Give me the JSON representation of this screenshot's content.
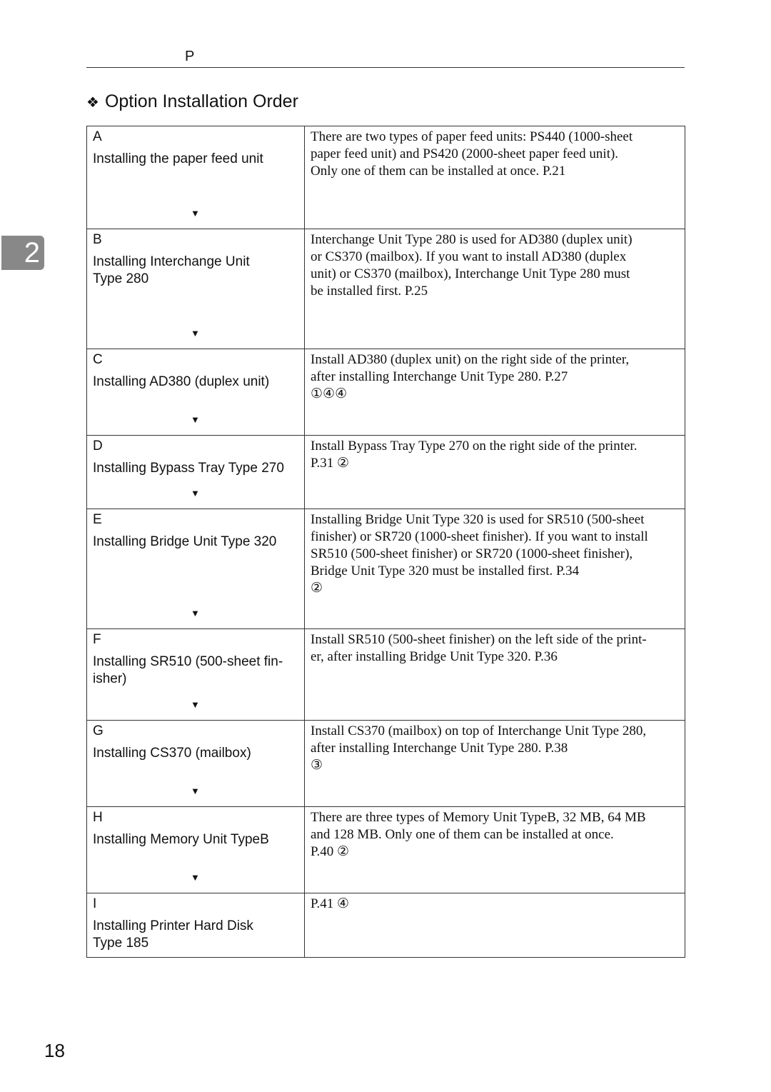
{
  "header": {
    "running_head": "P",
    "chapter_tab": "2",
    "page_number": "18"
  },
  "title": "Option Installation Order",
  "title_bullet": "❖",
  "rows": [
    {
      "letter": "A",
      "label": [
        "Installing the paper feed unit"
      ],
      "arrow": "▼",
      "height": 144,
      "desc": [
        "There are two types of paper feed units: PS440 (1000-sheet",
        "paper feed unit) and PS420 (2000-sheet paper feed unit).",
        "Only one of them can be installed at once.     P.21"
      ]
    },
    {
      "letter": "B",
      "label": [
        "Installing Interchange Unit",
        "Type 280"
      ],
      "arrow": "▼",
      "height": 168,
      "desc": [
        "Interchange Unit Type 280 is used for AD380 (duplex unit)",
        "or CS370 (mailbox). If you want to install AD380 (duplex",
        "unit) or CS370 (mailbox), Interchange Unit Type 280 must",
        "be installed first.     P.25"
      ]
    },
    {
      "letter": "C",
      "label": [
        "Installing AD380 (duplex unit)"
      ],
      "arrow": "▼",
      "height": 121,
      "desc": [
        "Install AD380 (duplex unit) on the right side of the printer,",
        "after installing Interchange Unit Type 280.     P.27",
        "①④④"
      ]
    },
    {
      "letter": "D",
      "label": [
        "Installing Bypass Tray Type 270"
      ],
      "arrow": "▼",
      "height": 103,
      "desc": [
        "Install Bypass Tray Type 270 on the right side of the printer.",
        "    P.31   ②"
      ]
    },
    {
      "letter": "E",
      "label": [
        "Installing Bridge Unit Type 320"
      ],
      "arrow": "▼",
      "height": 168,
      "desc": [
        "Installing Bridge Unit Type 320 is used for SR510 (500-sheet",
        "finisher) or SR720 (1000-sheet finisher). If you want to install",
        "SR510 (500-sheet finisher) or SR720 (1000-sheet finisher),",
        "Bridge Unit Type 320 must be installed first.     P.34",
        "②"
      ]
    },
    {
      "letter": "F",
      "label": [
        "Installing SR510 (500-sheet fin-",
        "isher)"
      ],
      "arrow": "▼",
      "height": 128,
      "desc": [
        "Install SR510 (500-sheet finisher) on the left side of the print-",
        "er, after installing Bridge Unit Type 320.     P.36"
      ]
    },
    {
      "letter": "G",
      "label": [
        "Installing CS370 (mailbox)"
      ],
      "arrow": "▼",
      "height": 121,
      "desc": [
        "Install CS370 (mailbox) on top of Interchange Unit Type 280,",
        "after installing Interchange Unit Type 280.     P.38",
        "③"
      ]
    },
    {
      "letter": "H",
      "label": [
        "Installing Memory Unit TypeB"
      ],
      "arrow": "▼",
      "height": 121,
      "desc": [
        "There are three types of Memory Unit TypeB, 32 MB, 64 MB",
        "and 128 MB. Only one of them can be installed at once.",
        "P.40   ②"
      ]
    },
    {
      "letter": "I",
      "label": [
        "Installing Printer Hard Disk",
        "Type 185"
      ],
      "arrow": "",
      "height": 90,
      "desc": [
        "    P.41   ④"
      ]
    }
  ]
}
